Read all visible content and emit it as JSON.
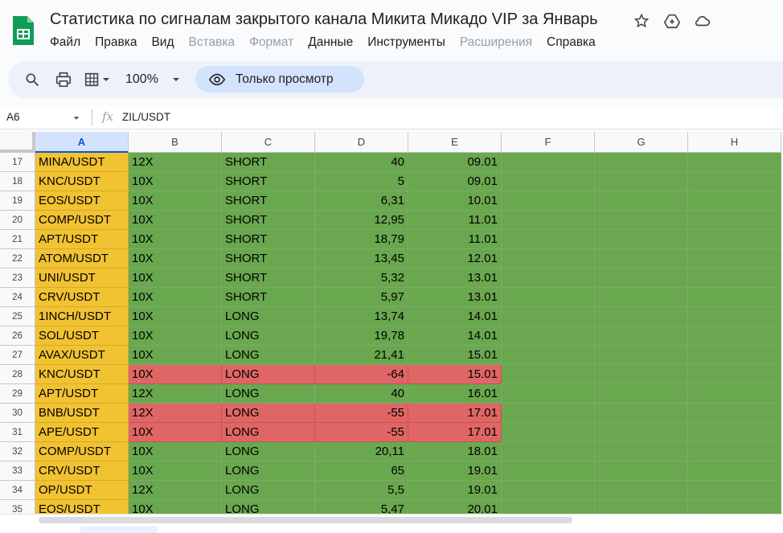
{
  "doc": {
    "title": "Статистика по сигналам закрытого канала Микита Микадо VIP  за Январь"
  },
  "menu": [
    {
      "label": "Файл",
      "enabled": true
    },
    {
      "label": "Правка",
      "enabled": true
    },
    {
      "label": "Вид",
      "enabled": true
    },
    {
      "label": "Вставка",
      "enabled": false
    },
    {
      "label": "Формат",
      "enabled": false
    },
    {
      "label": "Данные",
      "enabled": true
    },
    {
      "label": "Инструменты",
      "enabled": true
    },
    {
      "label": "Расширения",
      "enabled": false
    },
    {
      "label": "Справка",
      "enabled": true
    }
  ],
  "toolbar": {
    "zoom": "100%",
    "view_only_label": "Только просмотр"
  },
  "formula_bar": {
    "cell_ref": "A6",
    "fx": "fx",
    "value": "ZIL/USDT"
  },
  "columns": [
    "A",
    "B",
    "C",
    "D",
    "E",
    "F",
    "G",
    "H"
  ],
  "selected_column": "A",
  "colors": {
    "green": "#6aa84f",
    "red": "#e06666",
    "yellow": "#f1c232"
  },
  "rows": [
    {
      "n": "17",
      "a": "MINA/USDT",
      "b": "12X",
      "c": "SHORT",
      "d": "40",
      "e": "09.01",
      "status": "green"
    },
    {
      "n": "18",
      "a": "KNC/USDT",
      "b": "10X",
      "c": "SHORT",
      "d": "5",
      "e": "09.01",
      "status": "green"
    },
    {
      "n": "19",
      "a": "EOS/USDT",
      "b": "10X",
      "c": "SHORT",
      "d": "6,31",
      "e": "10.01",
      "status": "green"
    },
    {
      "n": "20",
      "a": "COMP/USDT",
      "b": "10X",
      "c": "SHORT",
      "d": "12,95",
      "e": "11.01",
      "status": "green"
    },
    {
      "n": "21",
      "a": "APT/USDT",
      "b": "10X",
      "c": "SHORT",
      "d": "18,79",
      "e": "11.01",
      "status": "green"
    },
    {
      "n": "22",
      "a": "ATOM/USDT",
      "b": "10X",
      "c": "SHORT",
      "d": "13,45",
      "e": "12.01",
      "status": "green"
    },
    {
      "n": "23",
      "a": "UNI/USDT",
      "b": "10X",
      "c": "SHORT",
      "d": "5,32",
      "e": "13.01",
      "status": "green"
    },
    {
      "n": "24",
      "a": "CRV/USDT",
      "b": "10X",
      "c": "SHORT",
      "d": "5,97",
      "e": "13.01",
      "status": "green"
    },
    {
      "n": "25",
      "a": "1INCH/USDT",
      "b": "10X",
      "c": "LONG",
      "d": "13,74",
      "e": "14.01",
      "status": "green"
    },
    {
      "n": "26",
      "a": "SOL/USDT",
      "b": "10X",
      "c": "LONG",
      "d": "19,78",
      "e": "14.01",
      "status": "green"
    },
    {
      "n": "27",
      "a": "AVAX/USDT",
      "b": "10X",
      "c": "LONG",
      "d": "21,41",
      "e": "15.01",
      "status": "green"
    },
    {
      "n": "28",
      "a": "KNC/USDT",
      "b": "10X",
      "c": "LONG",
      "d": "-64",
      "e": "15.01",
      "status": "red"
    },
    {
      "n": "29",
      "a": "APT/USDT",
      "b": "12X",
      "c": "LONG",
      "d": "40",
      "e": "16.01",
      "status": "green"
    },
    {
      "n": "30",
      "a": "BNB/USDT",
      "b": "12X",
      "c": "LONG",
      "d": "-55",
      "e": "17.01",
      "status": "red"
    },
    {
      "n": "31",
      "a": "APE/USDT",
      "b": "10X",
      "c": "LONG",
      "d": "-55",
      "e": "17.01",
      "status": "red"
    },
    {
      "n": "32",
      "a": "COMP/USDT",
      "b": "10X",
      "c": "LONG",
      "d": "20,11",
      "e": "18.01",
      "status": "green"
    },
    {
      "n": "33",
      "a": "CRV/USDT",
      "b": "10X",
      "c": "LONG",
      "d": "65",
      "e": "19.01",
      "status": "green"
    },
    {
      "n": "34",
      "a": "OP/USDT",
      "b": "12X",
      "c": "LONG",
      "d": "5,5",
      "e": "19.01",
      "status": "green"
    },
    {
      "n": "35",
      "a": "EOS/USDT",
      "b": "10X",
      "c": "LONG",
      "d": "5,47",
      "e": "20.01",
      "status": "green"
    }
  ]
}
